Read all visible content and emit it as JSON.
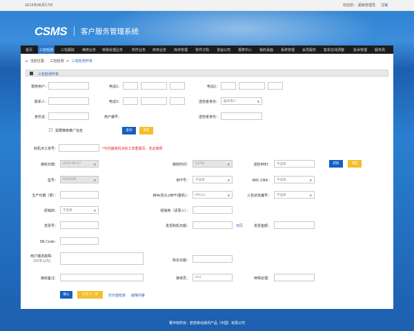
{
  "topbar": {
    "date": "2015年06月17日",
    "welcome": "欢迎您：",
    "user": "超级管理员",
    "logout": "注销"
  },
  "header": {
    "logo": "CSMS",
    "title": "客户服务管理系统"
  },
  "nav": [
    "首页",
    "三包检测",
    "三包跟踪",
    "维修业务",
    "特殊处理业务",
    "附件业务",
    "库存业务",
    "库存管理",
    "零件订购",
    "货运公司",
    "报表中心",
    "我的桌面",
    "系统管理",
    "会员服务",
    "售机在线调整",
    "投诉管理",
    "服务局"
  ],
  "breadcrumb": {
    "label": "当前位置：",
    "l1": "三包检测",
    "sep": ">",
    "l2": "三包检测开单"
  },
  "box_title": "三包检测开单",
  "customer": {
    "name_label": "报修用户：",
    "phone1_label": "电话1：",
    "phone2_label": "电话2：",
    "contact_label": "联系人：",
    "phone3_label": "电话3：",
    "address_label": "送检者身份：",
    "address_value": "最终用户",
    "region_label": "身份证：",
    "user_no_label": "用户编号：",
    "sender_label": "送检者身份：",
    "promo_label": "需要推荐推广信息",
    "search_btn": "查询",
    "clear_btn": "清空"
  },
  "form": {
    "ticket_label": "收机点工单号：",
    "ticket_note": "*与扫描收机点的工单重填写：非必填项",
    "recv_date_label": "接收日期：",
    "recv_date_value": "2015-06-17",
    "recv_time_label": "接收时间：",
    "recv_time_value": "13:54",
    "imei_label": "送检IMEI：",
    "imei_value": "不选择",
    "fetch_btn": "获取",
    "clear_btn": "清空",
    "model_label": "型号：",
    "model_value": "A2015BC",
    "bpt_label": "BPT号：",
    "bpt_value": "不选择",
    "rrc_label": "RRC-CBA：",
    "rrc_value": "不选择",
    "prod_date_label": "生产日期（周）：",
    "bpa_label": "BPA(机头)/BPT(整机)：",
    "bpa_value": "IPA(头)",
    "status_label": "三包状态编号：",
    "status_value": "不选择",
    "dealer_label": "经销商：",
    "dealer_value": "不选择",
    "dealer2_label": "经销商（请录入）：",
    "invoice_no_label": "发票号：",
    "invoice_date_label": "发票购机日期：",
    "invoice_tag": "日历",
    "invoice_amt_label": "发票金额：",
    "sn_label": "SN Code：",
    "fault_label": "用户描述故障：",
    "fault_sub": "(50字以内)",
    "buy_date_label": "购买日期：",
    "recv_note_label": "接收备注：",
    "receiver_label": "接待员：",
    "receiver_value": "test",
    "special_label": "特殊处理："
  },
  "actions": {
    "confirm": "确认",
    "next": "打开下一单",
    "print": "打印送检单",
    "fault_query": "故障问答"
  },
  "footer": {
    "text": "著作权所有：若若移动通讯产品（中国）有限公司"
  }
}
